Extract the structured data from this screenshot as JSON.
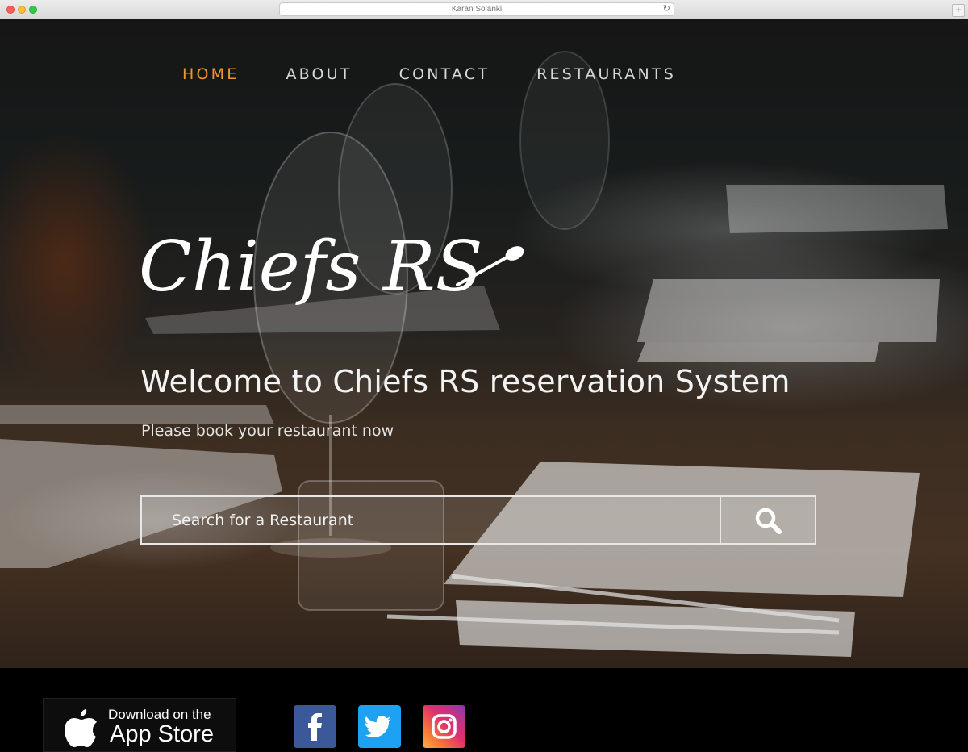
{
  "browser": {
    "url_text": "Karan Solanki"
  },
  "nav": {
    "items": [
      {
        "label": "HOME",
        "active": true
      },
      {
        "label": "ABOUT",
        "active": false
      },
      {
        "label": "CONTACT",
        "active": false
      },
      {
        "label": "RESTAURANTS",
        "active": false
      }
    ],
    "active_color": "#f0962f"
  },
  "hero": {
    "logo_text": "Chiefs RS",
    "welcome": "Welcome to Chiefs RS reservation System",
    "subtitle": "Please book your restaurant now"
  },
  "search": {
    "placeholder": "Search for a Restaurant",
    "value": "",
    "icon": "search-icon"
  },
  "footer": {
    "app_store": {
      "line1": "Download on the",
      "line2": "App Store",
      "icon": "apple-icon"
    },
    "social": [
      {
        "name": "facebook",
        "icon": "facebook-icon",
        "color": "#3b5998"
      },
      {
        "name": "twitter",
        "icon": "twitter-icon",
        "color": "#1da1f2"
      },
      {
        "name": "instagram",
        "icon": "instagram-icon",
        "color": "#e1306c"
      }
    ]
  }
}
